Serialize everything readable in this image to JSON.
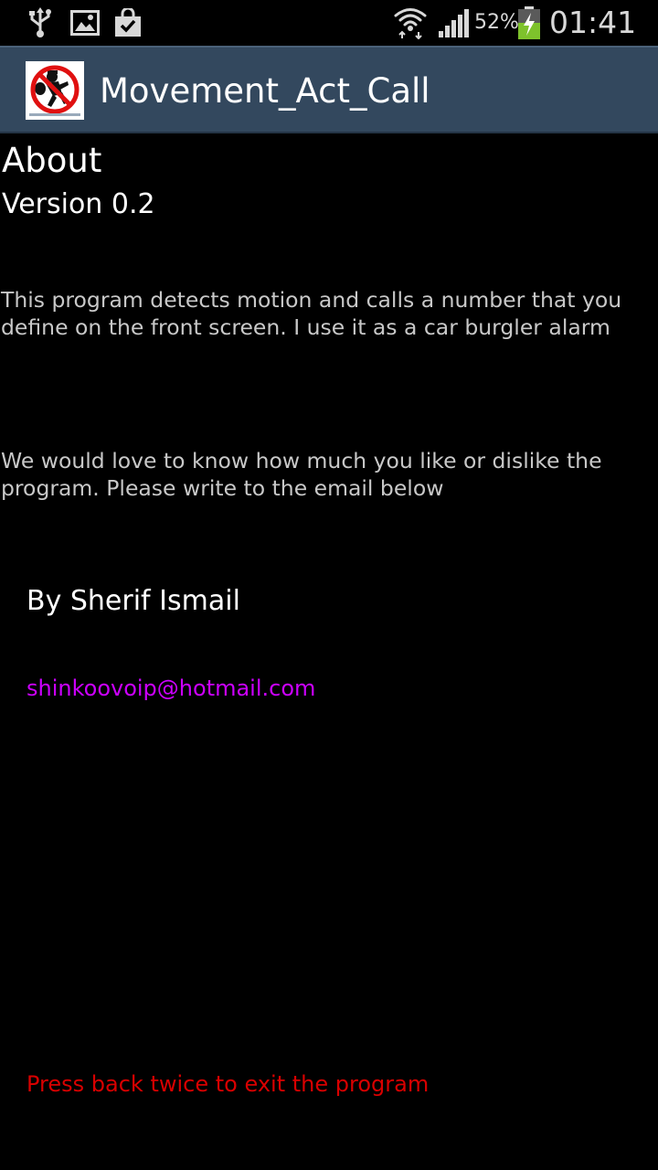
{
  "status_bar": {
    "battery": "52%",
    "time": "01:41",
    "icons": [
      "usb-icon",
      "gallery-icon",
      "store-bag-icon",
      "wifi-icon",
      "signal-icon",
      "battery-charging-icon"
    ]
  },
  "action_bar": {
    "title": "Movement_Act_Call",
    "icon": "no-burglar-icon"
  },
  "about": {
    "title": "About",
    "version": "Version 0.2",
    "description": "This program detects motion and calls a number that you define on the front screen. I use it as a car burgler alarm",
    "feedback": "We would love to know how much you like or dislike the program. Please write to the email below",
    "author": "By Sherif Ismail",
    "email": "shinkoovoip@hotmail.com",
    "exit_hint": "Press back twice to exit the program"
  },
  "colors": {
    "action_bar": "#33485e",
    "email": "#cc00ff",
    "exit_hint": "#d80000",
    "battery_charging": "#7ec22c"
  }
}
